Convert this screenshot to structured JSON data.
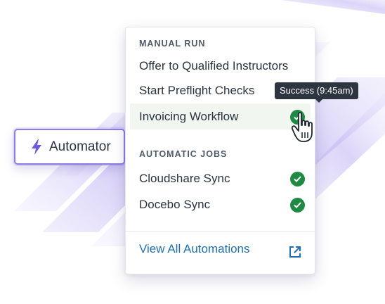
{
  "automator_button": {
    "label": "Automator",
    "icon": "lightning-bolt-icon"
  },
  "menu": {
    "manual_run": {
      "heading": "MANUAL RUN",
      "items": [
        {
          "label": "Offer to Qualified Instructors",
          "status": null
        },
        {
          "label": "Start Preflight Checks",
          "status": null
        },
        {
          "label": "Invoicing Workflow",
          "status": "success",
          "highlighted": true
        }
      ]
    },
    "automatic_jobs": {
      "heading": "AUTOMATIC JOBS",
      "items": [
        {
          "label": "Cloudshare Sync",
          "status": "success"
        },
        {
          "label": "Docebo Sync",
          "status": "success"
        }
      ]
    },
    "footer": {
      "link_label": "View All Automations",
      "icon": "external-link-icon"
    }
  },
  "tooltip": {
    "text": "Success (9:45am)"
  },
  "colors": {
    "accent_purple": "#8b7de6",
    "success_green": "#1f8a44",
    "link_blue": "#1f6fb2",
    "highlight_row": "#f1f6f1",
    "tooltip_bg": "#2c3540"
  }
}
